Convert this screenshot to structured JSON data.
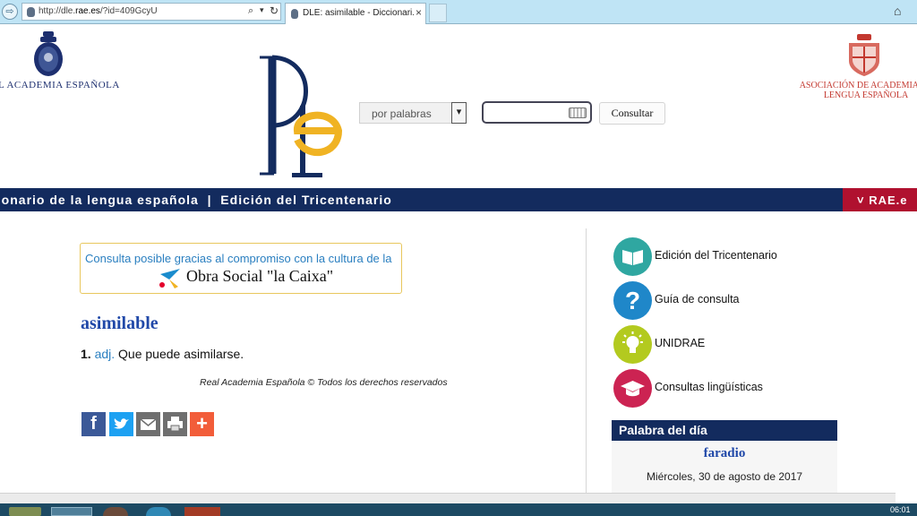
{
  "browser": {
    "url_prefix": "http://dle.",
    "url_domain": "rae.es",
    "url_suffix": "/?id=409GcyU",
    "tab_title": "DLE: asimilable - Diccionari...",
    "tab_close": "×",
    "search_icon": "⌕",
    "dropdown_icon": "▾",
    "refresh_icon": "↻",
    "home_icon": "⌂",
    "nav_icon": "⇨"
  },
  "header": {
    "rae_name": "L ACADEMIA ESPAÑOLA",
    "asale_line1": "ASOCIACIÓN DE ACADEMIAS D",
    "asale_line2": "LENGUA ESPAÑOLA",
    "search_mode": "por palabras",
    "search_mode_arrow": "▾",
    "search_value": "",
    "consult_button": "Consultar"
  },
  "band": {
    "text": "cionario de la lengua española  |  Edición del Tricentenario",
    "rae_tab": "˅ RAE.e"
  },
  "sponsor": {
    "text": "Consulta posible gracias al compromiso con la cultura de la",
    "brand": "Obra Social \"la Caixa\""
  },
  "entry": {
    "word": "asimilable",
    "number": "1.",
    "abbr": "adj.",
    "definition": "Que puede asimilarse.",
    "copyright": "Real Academia Española © Todos los derechos reservados"
  },
  "share": {
    "facebook": "f",
    "more": "+"
  },
  "side": {
    "items": [
      {
        "label": "Edición del Tricentenario",
        "icon": "book-icon"
      },
      {
        "label": "Guía de consulta",
        "icon": "question-icon"
      },
      {
        "label": "UNIDRAE",
        "icon": "lightbulb-icon"
      },
      {
        "label": "Consultas lingüísticas",
        "icon": "graduation-cap-icon"
      }
    ],
    "guia_symbol": "?"
  },
  "palabra_del_dia": {
    "title": "Palabra del día",
    "word": "faradio",
    "date": "Miércoles, 30 de agosto de 2017"
  },
  "taskbar": {
    "clock": "06:01"
  },
  "colors": {
    "navy": "#132b5e",
    "rae_red": "#b0112f",
    "teal": "#2fa7a1",
    "blue": "#1f87c9",
    "lime": "#b3ca1f",
    "crimson": "#cc2352",
    "gold": "#f0b323"
  }
}
